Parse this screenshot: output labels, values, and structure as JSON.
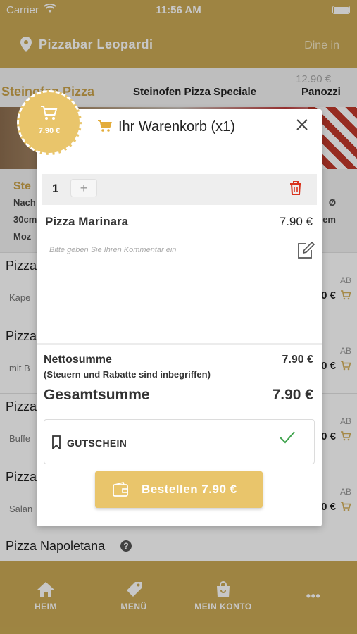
{
  "status_bar": {
    "carrier": "Carrier",
    "time": "11:56 AM"
  },
  "header": {
    "restaurant": "Pizzabar Leopardi",
    "mode": "Dine in"
  },
  "category_tabs": {
    "ghost_price": "12.90 €",
    "items": [
      "Steinofen Pizza",
      "Steinofen Pizza Speciale",
      "Panozzi"
    ]
  },
  "info_block": {
    "title": "Ste",
    "lines": [
      "Nach",
      "30cm",
      "Moz"
    ],
    "right_lines": [
      "Ø",
      "em"
    ]
  },
  "menu_items": [
    {
      "name": "Pizza",
      "desc": "Kape",
      "ab": "AB",
      "price": "0 €"
    },
    {
      "name": "Pizza",
      "desc": "mit B",
      "ab": "AB",
      "price": "0 €"
    },
    {
      "name": "Pizza",
      "desc": "Buffe",
      "ab": "AB",
      "price": "0 €"
    },
    {
      "name": "Pizza",
      "desc": "Salan",
      "ab": "AB",
      "price": "0 €"
    }
  ],
  "visible_item": {
    "name": "Pizza Napoletana",
    "help": "?"
  },
  "bottom_nav": {
    "home": "HEIM",
    "menu": "MENÜ",
    "account": "MEIN KONTO",
    "more": "•••"
  },
  "cart_badge": {
    "price": "7.90 €"
  },
  "cart_modal": {
    "title": "Ihr Warenkorb (x1)",
    "quantity": "1",
    "plus": "+",
    "item_name": "Pizza Marinara",
    "item_price": "7.90 €",
    "comment_placeholder": "Bitte geben Sie Ihren Kommentar ein",
    "net_label": "Nettosumme",
    "net_note": "(Steuern und Rabatte sind inbegriffen)",
    "net_price": "7.90 €",
    "total_label": "Gesamtsumme",
    "total_price": "7.90 €",
    "voucher_label": "GUTSCHEIN",
    "order_button": "Bestellen 7.90 €"
  },
  "colors": {
    "brand": "#cbaa55",
    "accent": "#e9c56b",
    "danger": "#d9341e",
    "success": "#3fa34d"
  }
}
